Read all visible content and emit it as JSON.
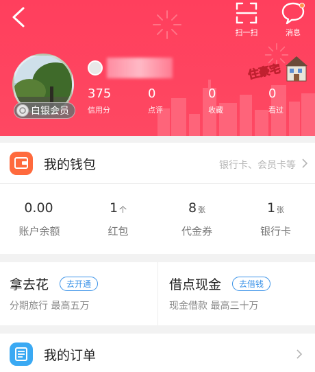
{
  "colors": {
    "header": "#fe4862",
    "wallet_icon": "#ff6a3d",
    "orders_icon": "#3aa9f3",
    "pill": "#3b93e8"
  },
  "header": {
    "back_icon": "chevron-left-icon",
    "actions": [
      {
        "label": "扫一扫",
        "icon": "scan-icon"
      },
      {
        "label": "消息",
        "icon": "message-bubble-icon"
      }
    ]
  },
  "profile": {
    "member_level": "白银会员",
    "stats": [
      {
        "value": "375",
        "label": "信用分"
      },
      {
        "value": "0",
        "label": "点评"
      },
      {
        "value": "0",
        "label": "收藏"
      },
      {
        "value": "0",
        "label": "看过"
      }
    ],
    "promo_badge": "住豪宅"
  },
  "wallet": {
    "title": "我的钱包",
    "hint": "银行卡、会员卡等",
    "items": [
      {
        "value": "0.00",
        "unit": "",
        "label": "账户余额"
      },
      {
        "value": "1",
        "unit": "个",
        "label": "红包"
      },
      {
        "value": "8",
        "unit": "张",
        "label": "代金券"
      },
      {
        "value": "1",
        "unit": "张",
        "label": "银行卡"
      }
    ]
  },
  "finance": [
    {
      "title": "拿去花",
      "button": "去开通",
      "subtitle": "分期旅行 最高五万"
    },
    {
      "title": "借点现金",
      "button": "去借钱",
      "subtitle": "现金借款 最高三十万"
    }
  ],
  "orders": {
    "title": "我的订单"
  }
}
